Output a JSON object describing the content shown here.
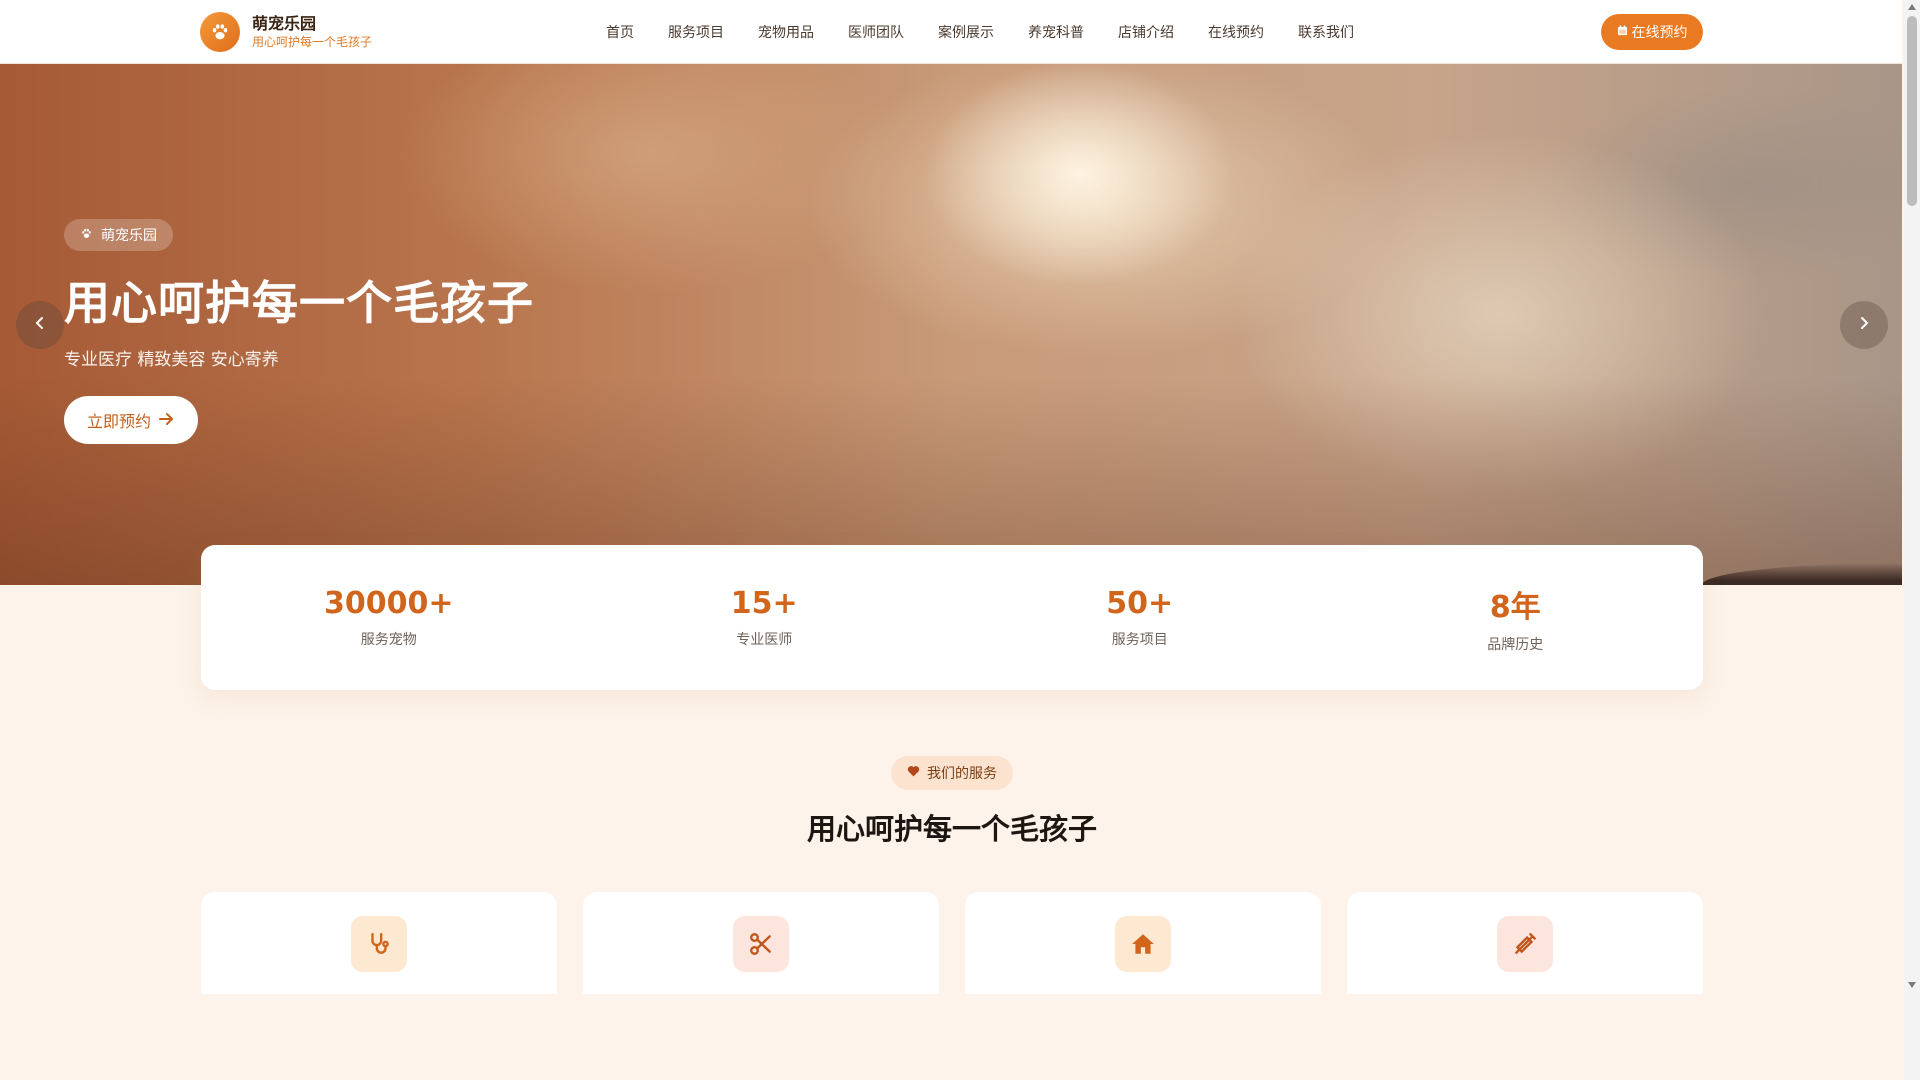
{
  "header": {
    "logo_name": "萌宠乐园",
    "logo_slogan": "用心呵护每一个毛孩子",
    "nav": [
      "首页",
      "服务项目",
      "宠物用品",
      "医师团队",
      "案例展示",
      "养宠科普",
      "店铺介绍",
      "在线预约",
      "联系我们"
    ],
    "cta_label": "在线预约"
  },
  "hero": {
    "tag": "萌宠乐园",
    "title": "用心呵护每一个毛孩子",
    "subtitle": "专业医疗 精致美容 安心寄养",
    "button_label": "立即预约"
  },
  "stats": [
    {
      "value": "30000+",
      "label": "服务宠物"
    },
    {
      "value": "15+",
      "label": "专业医师"
    },
    {
      "value": "50+",
      "label": "服务项目"
    },
    {
      "value": "8年",
      "label": "品牌历史"
    }
  ],
  "services": {
    "tag": "我们的服务",
    "title": "用心呵护每一个毛孩子",
    "cards": [
      {
        "icon": "stethoscope-icon"
      },
      {
        "icon": "scissors-icon"
      },
      {
        "icon": "house-icon"
      },
      {
        "icon": "syringe-icon"
      }
    ]
  },
  "colors": {
    "accent": "#ea7a22",
    "stat_number": "#d0651b",
    "page_background": "#fdf3ea"
  }
}
